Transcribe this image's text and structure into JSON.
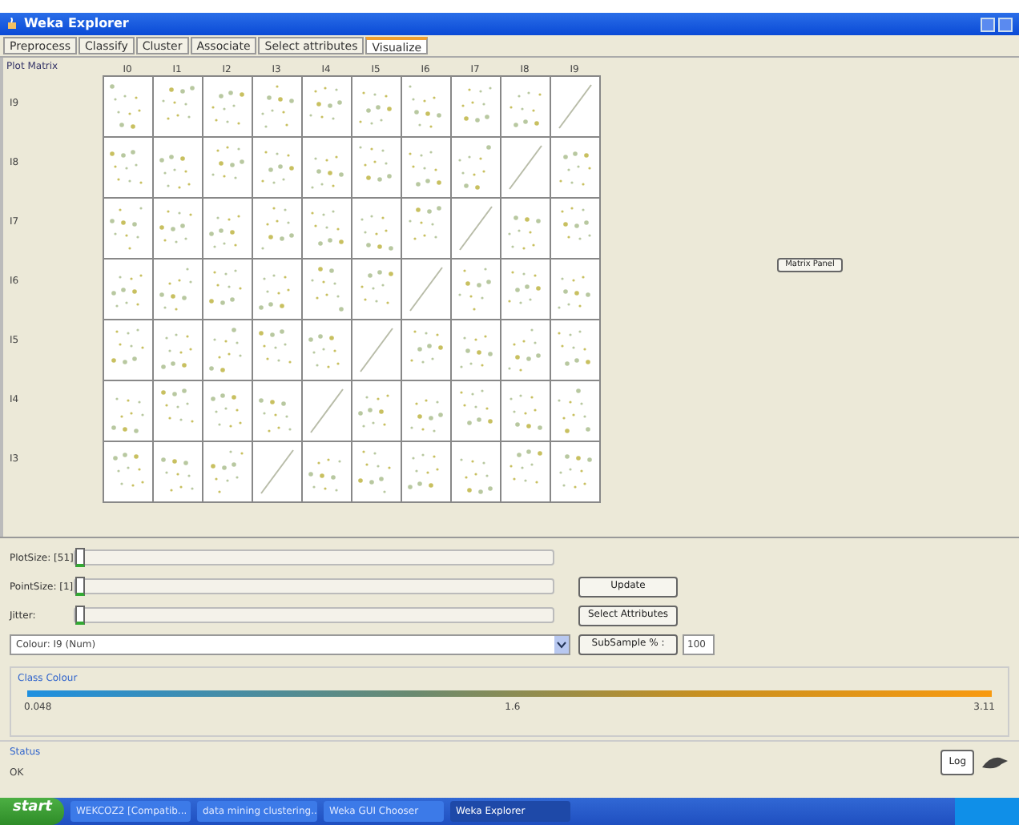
{
  "window": {
    "title": "Weka Explorer"
  },
  "tabs": [
    {
      "label": "Preprocess",
      "selected": false
    },
    {
      "label": "Classify",
      "selected": false
    },
    {
      "label": "Cluster",
      "selected": false
    },
    {
      "label": "Associate",
      "selected": false
    },
    {
      "label": "Select attributes",
      "selected": false
    },
    {
      "label": "Visualize",
      "selected": true
    }
  ],
  "plot_matrix": {
    "title": "Plot Matrix",
    "column_labels": [
      "I0",
      "I1",
      "I2",
      "I3",
      "I4",
      "I5",
      "I6",
      "I7",
      "I8",
      "I9"
    ],
    "row_labels": [
      "I9",
      "I8",
      "I7",
      "I6",
      "I5",
      "I4",
      "I3"
    ],
    "panel_button": "Matrix Panel"
  },
  "sliders": [
    {
      "label": "PlotSize: [51]",
      "level": 0
    },
    {
      "label": "PointSize: [1]",
      "level": 0
    },
    {
      "label": "Jitter:",
      "level": 0
    }
  ],
  "colour_select": {
    "value": "Colour: I9 (Num)"
  },
  "buttons": [
    "Update",
    "Select Attributes"
  ],
  "subsample": {
    "label": "SubSample % :",
    "value": "100"
  },
  "class_colour": {
    "title": "Class Colour",
    "ticks": [
      "0.048",
      "1.6",
      "3.11"
    ]
  },
  "status": {
    "title": "Status",
    "message": "OK",
    "log_button": "Log"
  },
  "taskbar": {
    "start": "start",
    "items": [
      {
        "label": "WEKCOZ2 [Compatib...",
        "selected": false
      },
      {
        "label": "data mining clustering...",
        "selected": false
      },
      {
        "label": "Weka GUI Chooser",
        "selected": false
      },
      {
        "label": "Weka Explorer",
        "selected": true
      }
    ]
  }
}
